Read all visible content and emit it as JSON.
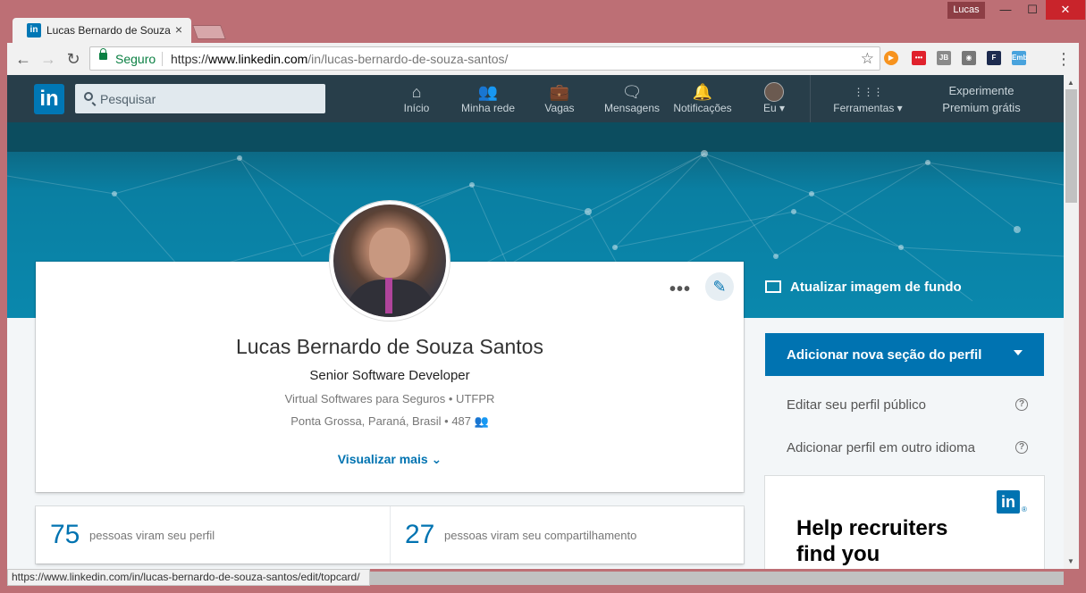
{
  "window": {
    "user": "Lucas",
    "minimize": "—",
    "maximize": "☐",
    "close": "✕"
  },
  "tab": {
    "title": "Lucas Bernardo de Souza",
    "favicon": "in",
    "close": "×"
  },
  "browser": {
    "back_icon": "←",
    "forward_icon": "→",
    "reload_icon": "↻",
    "secure_label": "Seguro",
    "url_scheme": "https://",
    "url_host": "www.linkedin.com",
    "url_path": "/in/lucas-bernardo-de-souza-santos/",
    "star_icon": "☆",
    "menu_icon": "⋮",
    "extensions": [
      {
        "name": "play-extension-icon",
        "label": "▶",
        "color": "#f7931e"
      },
      {
        "name": "todo-extension-icon",
        "label": "•••",
        "color": "#e0212c"
      },
      {
        "name": "jb-extension-icon",
        "label": "JB",
        "color": "#8a8a8a"
      },
      {
        "name": "camera-extension-icon",
        "label": "◉",
        "color": "#777777"
      },
      {
        "name": "f-extension-icon",
        "label": "F",
        "color": "#1d2b4f"
      },
      {
        "name": "emb-extension-icon",
        "label": "Emb",
        "color": "#49a3dd"
      }
    ]
  },
  "linkedin_nav": {
    "logo": "in",
    "search_placeholder": "Pesquisar",
    "items": [
      {
        "label": "Início",
        "icon": "⌂"
      },
      {
        "label": "Minha rede",
        "icon": "👥"
      },
      {
        "label": "Vagas",
        "icon": "💼"
      },
      {
        "label": "Mensagens",
        "icon": "🗨"
      },
      {
        "label": "Notificações",
        "icon": "🔔"
      },
      {
        "label": "Eu ▾",
        "icon": "avatar"
      },
      {
        "label": "Ferramentas ▾",
        "icon": "⋮⋮⋮"
      }
    ],
    "premium_line1": "Experimente",
    "premium_line2": "Premium grátis"
  },
  "profile": {
    "update_background": "Atualizar imagem de fundo",
    "name": "Lucas Bernardo de Souza Santos",
    "headline": "Senior Software Developer",
    "company": "Virtual Softwares para Seguros • UTFPR",
    "location": "Ponta Grossa, Paraná, Brasil • 487 👥",
    "view_more": "Visualizar mais ⌄",
    "more_icon": "•••",
    "edit_icon": "✎"
  },
  "stats": [
    {
      "value": "75",
      "label": "pessoas viram seu perfil"
    },
    {
      "value": "27",
      "label": "pessoas viram seu compartilhamento"
    }
  ],
  "sidebar": {
    "add_section": "Adicionar nova seção do perfil",
    "edit_public": "Editar seu perfil público",
    "add_language": "Adicionar perfil em outro idioma",
    "help_icon": "?"
  },
  "ad": {
    "logo": "in",
    "reg": "®",
    "text": "Help recruiters find you"
  },
  "status_bar": "https://www.linkedin.com/in/lucas-bernardo-de-souza-santos/edit/topcard/"
}
